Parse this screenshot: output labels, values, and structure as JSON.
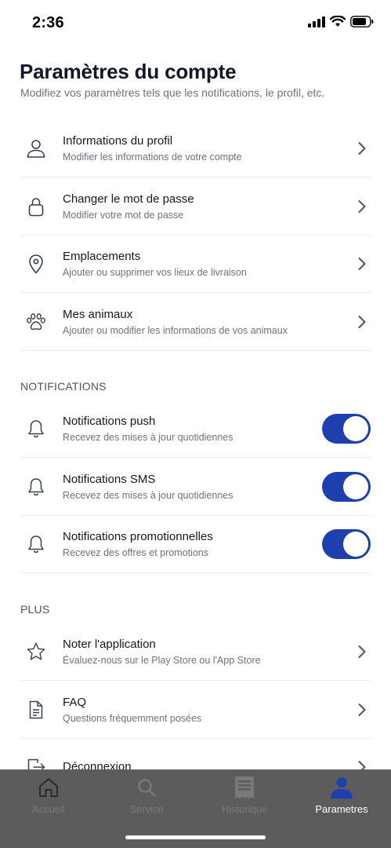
{
  "status_bar": {
    "time": "2:36"
  },
  "header": {
    "title": "Paramètres du compte",
    "subtitle": "Modifiez vos paramètres tels que les notifications, le profil, etc."
  },
  "account_items": [
    {
      "icon": "user-icon",
      "title": "Informations du profil",
      "subtitle": "Modifier les informations de votre compte"
    },
    {
      "icon": "lock-icon",
      "title": "Changer le mot de passe",
      "subtitle": "Modifier votre mot de passe"
    },
    {
      "icon": "location-pin-icon",
      "title": "Emplacements",
      "subtitle": "Ajouter ou supprimer vos lieux de livraison"
    },
    {
      "icon": "paw-icon",
      "title": "Mes animaux",
      "subtitle": "Ajouter ou modifier les informations de vos animaux"
    }
  ],
  "notifications": {
    "label": "NOTIFICATIONS",
    "items": [
      {
        "icon": "bell-icon",
        "title": "Notifications push",
        "subtitle": "Recevez des mises à jour quotidiennes",
        "enabled": true
      },
      {
        "icon": "bell-icon",
        "title": "Notifications SMS",
        "subtitle": "Recevez des mises à jour quotidiennes",
        "enabled": true
      },
      {
        "icon": "bell-icon",
        "title": "Notifications promotionnelles",
        "subtitle": "Recevez des offres et promotions",
        "enabled": true
      }
    ]
  },
  "plus": {
    "label": "PLUS",
    "items": [
      {
        "icon": "star-icon",
        "title": "Noter l'application",
        "subtitle": "Évaluez-nous sur le Play Store ou l'App Store"
      },
      {
        "icon": "document-icon",
        "title": "FAQ",
        "subtitle": "Questions fréquemment posées"
      },
      {
        "icon": "logout-icon",
        "title": "Déconnexion",
        "subtitle": ""
      }
    ]
  },
  "tabbar": {
    "tabs": [
      {
        "icon": "home-icon",
        "label": "Accueil",
        "active": false
      },
      {
        "icon": "search-icon",
        "label": "Service",
        "active": false
      },
      {
        "icon": "receipt-icon",
        "label": "Historique",
        "active": false
      },
      {
        "icon": "profile-icon",
        "label": "Parametres",
        "active": true
      }
    ]
  },
  "colors": {
    "accent": "#1e40af",
    "tabbar_bg": "#5c5c5c",
    "active_tab_icon": "#1e40af"
  }
}
